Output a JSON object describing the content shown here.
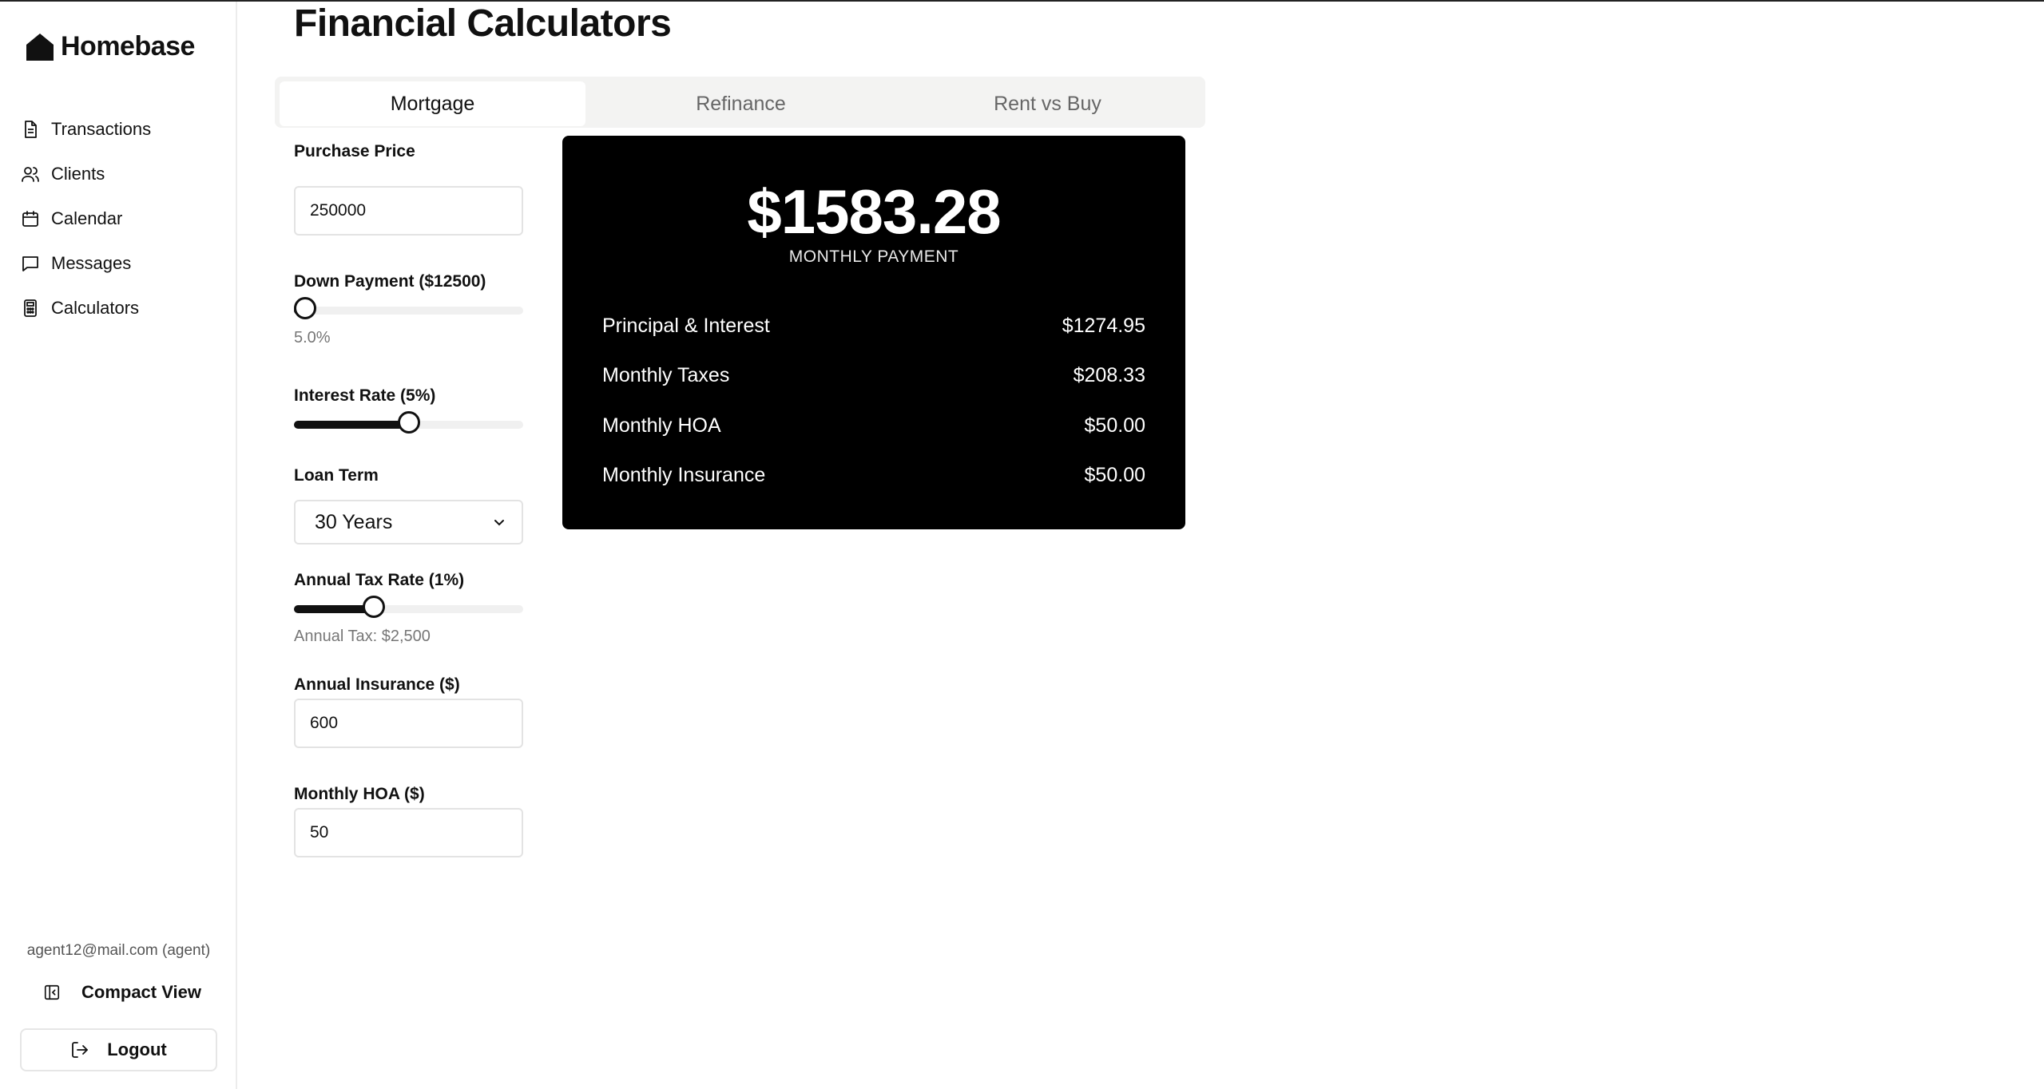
{
  "app": {
    "brand": "Homebase"
  },
  "sidebar": {
    "items": [
      {
        "label": "Transactions",
        "icon": "document-icon"
      },
      {
        "label": "Clients",
        "icon": "users-icon"
      },
      {
        "label": "Calendar",
        "icon": "calendar-icon"
      },
      {
        "label": "Messages",
        "icon": "message-icon"
      },
      {
        "label": "Calculators",
        "icon": "calculator-icon"
      }
    ],
    "user_email": "agent12@mail.com (agent)",
    "compact_view_label": "Compact View",
    "logout_label": "Logout"
  },
  "page": {
    "title": "Financial Calculators"
  },
  "tabs": [
    {
      "label": "Mortgage",
      "active": true
    },
    {
      "label": "Refinance",
      "active": false
    },
    {
      "label": "Rent vs Buy",
      "active": false
    }
  ],
  "form": {
    "purchase_price_label": "Purchase Price",
    "purchase_price_value": "250000",
    "down_payment_label": "Down Payment ($12500)",
    "down_payment_percent_text": "5.0%",
    "down_payment_fraction": 0.05,
    "interest_rate_label": "Interest Rate (5%)",
    "interest_rate_fraction": 0.5,
    "loan_term_label": "Loan Term",
    "loan_term_value": "30 Years",
    "tax_rate_label": "Annual Tax Rate (1%)",
    "tax_rate_fraction": 0.35,
    "annual_tax_text": "Annual Tax: $2,500",
    "insurance_label": "Annual Insurance ($)",
    "insurance_value": "600",
    "hoa_label": "Monthly HOA ($)",
    "hoa_value": "50"
  },
  "result": {
    "monthly_payment": "$1583.28",
    "monthly_payment_caption": "MONTHLY PAYMENT",
    "breakdown": [
      {
        "label": "Principal & Interest",
        "value": "$1274.95"
      },
      {
        "label": "Monthly Taxes",
        "value": "$208.33"
      },
      {
        "label": "Monthly HOA",
        "value": "$50.00"
      },
      {
        "label": "Monthly Insurance",
        "value": "$50.00"
      }
    ]
  }
}
